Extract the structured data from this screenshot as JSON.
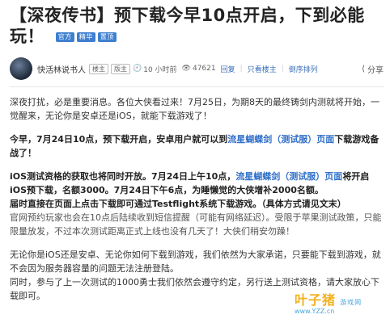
{
  "article": {
    "title_part1": "【深夜传书】预下载今早10点开启，下到必能",
    "title_part2": "玩！",
    "tags": [
      "官方",
      "精华",
      "置顶"
    ]
  },
  "meta": {
    "author": "快活林说书人",
    "badge1": "楼主",
    "badge2": "版主",
    "time": "10 小时前",
    "views": "47621",
    "reply": "回复",
    "only_owner": "只看楼主",
    "reverse": "倒序排列",
    "share": "分享"
  },
  "content": {
    "p1": "深夜打扰，必是重要消息。各位大侠看过来！7月25日，为期8天的最终铸剑内测就将开始，一觉醒来，无论你是安卓还是iOS，就能下载游戏了！",
    "p2_a": "今早，7月24日10点，预下载开启，安卓用户就可以到",
    "p2_link": "流星蝴蝶剑（测试服）页面",
    "p2_b": "下载游戏备战了！",
    "p3_a": "iOS测试资格的获取也将同时开放。7月24日上午10点，",
    "p3_link": "流星蝴蝶剑（测试服）页面",
    "p3_b": "将开启iOS预下载，名额3000。7月24日下午6点，为睡懒觉的大侠增补2000名额。",
    "p4": "届时直接在页面上点击下载即可通过Testflight系统下载游戏。（具体方式请见文末）",
    "p5": "官网预约玩家也会在10点后陆续收到短信提醒（可能有网络延迟）。受限于苹果测试政策，只能限量放发，不过本次测试距离正式上线也没有几天了！大侠们稍安勿躁！",
    "p6": "无论你是iOS还是安卓、无论你如何下载到游戏，我们依然为大家承诺，只要能下载到游戏，就不会因为服务器容量的问题无法注册登陆。",
    "p7": "同时，参与了上一次测试的1000勇士我们依然会遵守约定，另行送上测试资格，请大家放心下载即可。"
  },
  "watermark": {
    "main": "叶子猪",
    "sub": "游戏网",
    "url": "www.YZZ.cn"
  }
}
